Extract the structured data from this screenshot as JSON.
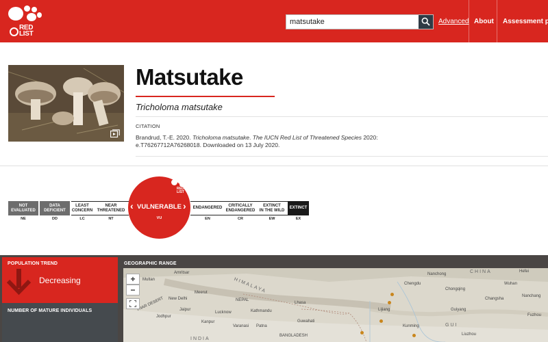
{
  "header": {
    "logo_text_line1": "RED",
    "logo_text_line2": "LIST",
    "search": {
      "value": "matsutake",
      "icon": "search-icon"
    },
    "nav": {
      "advanced": "Advanced",
      "about": "About",
      "assessment": "Assessment pro"
    },
    "colors": {
      "brand_red": "#d8261f",
      "search_button": "#2f3b45"
    }
  },
  "species": {
    "common_name": "Matsutake",
    "scientific_name": "Tricholoma matsutake",
    "photo_gallery_icon": "gallery-icon",
    "citation": {
      "label": "CITATION",
      "authors_year": "Brandrud, T.-E. 2020.",
      "species": "Tricholoma matsutake",
      "source": "The IUCN Red List of Threatened Species",
      "rest": " 2020: e.T76267712A76268018. Downloaded on 13 July 2020."
    }
  },
  "status_scale": {
    "categories": [
      {
        "line1": "NOT",
        "line2": "EVALUATED",
        "abbr": "NE"
      },
      {
        "line1": "DATA",
        "line2": "DEFICIENT",
        "abbr": "DD"
      },
      {
        "line1": "LEAST",
        "line2": "CONCERN",
        "abbr": "LC"
      },
      {
        "line1": "NEAR",
        "line2": "THREATENED",
        "abbr": "NT"
      },
      {
        "line1": "VULNERABLE",
        "line2": "",
        "abbr": "VU"
      },
      {
        "line1": "ENDANGERED",
        "line2": "",
        "abbr": "EN"
      },
      {
        "line1": "CRITICALLY",
        "line2": "ENDANGERED",
        "abbr": "CR"
      },
      {
        "line1": "EXTINCT",
        "line2": "IN THE WILD",
        "abbr": "EW"
      },
      {
        "line1": "EXTINCT",
        "line2": "",
        "abbr": "EX"
      }
    ],
    "current": "VULNERABLE",
    "current_abbr": "VU",
    "prev_icon": "chevron-left-icon",
    "next_icon": "chevron-right-icon",
    "badge_logo_line1": "RED",
    "badge_logo_line2": "LIST"
  },
  "population": {
    "label": "POPULATION TREND",
    "value": "Decreasing",
    "icon": "arrow-down-icon",
    "mature_label": "NUMBER OF MATURE INDIVIDUALS"
  },
  "range": {
    "label": "GEOGRAPHIC RANGE",
    "zoom_in": "+",
    "zoom_out": "−",
    "fullscreen_icon": "fullscreen-icon",
    "place_labels": {
      "multan": "Multan",
      "amritsar": "Amritsar",
      "new_delhi": "New Delhi",
      "meerut": "Meerut",
      "jodhpur": "Jodhpur",
      "jaipur": "Jaipur",
      "lucknow": "Lucknow",
      "kanpur": "Kanpur",
      "varanasi": "Varanasi",
      "patna": "Patna",
      "kathmandu": "Kathmandu",
      "nepal": "NEPAL",
      "guwahati": "Guwahati",
      "bangladesh": "BANGLADESH",
      "india": "INDIA",
      "himalaya": "HIMALAYA",
      "thar": "THAR DESERT",
      "lhasa": "Lhasa",
      "lijiang": "Lijiang",
      "kunming": "Kunming",
      "nanchong": "Nanchong",
      "hefei": "Hefei",
      "wuhan": "Wuhan",
      "chengdu": "Chengdu",
      "chongqing": "Chongqing",
      "changsha": "Changsha",
      "nanchang": "Nanchang",
      "guiyang": "Guiyang",
      "liuzhou": "Liuzhou",
      "fuzhou": "Fuzhou",
      "china": "CHINA",
      "gui": "GUI"
    }
  }
}
